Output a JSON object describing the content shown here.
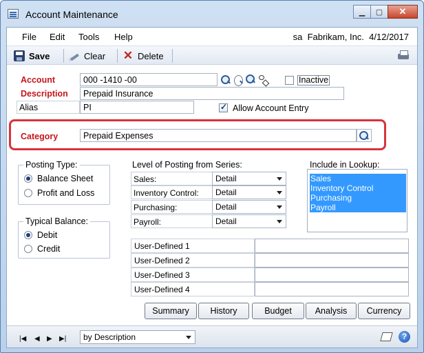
{
  "window": {
    "title": "Account Maintenance"
  },
  "menu": {
    "items": [
      "File",
      "Edit",
      "Tools",
      "Help"
    ],
    "user": "sa",
    "company": "Fabrikam, Inc.",
    "date": "4/12/2017"
  },
  "toolbar": {
    "save": "Save",
    "clear": "Clear",
    "delete": "Delete"
  },
  "form": {
    "account_label": "Account",
    "account_value": "000 -1410 -00",
    "inactive_label": "Inactive",
    "inactive_checked": false,
    "description_label": "Description",
    "description_value": "Prepaid Insurance",
    "alias_label": "Alias",
    "alias_value": "PI",
    "allow_entry_label": "Allow Account Entry",
    "allow_entry_checked": true,
    "category_label": "Category",
    "category_value": "Prepaid Expenses"
  },
  "posting_type": {
    "title": "Posting Type:",
    "options": [
      "Balance Sheet",
      "Profit and Loss"
    ],
    "selected": "Balance Sheet"
  },
  "typical_balance": {
    "title": "Typical Balance:",
    "options": [
      "Debit",
      "Credit"
    ],
    "selected": "Debit"
  },
  "level_of_posting": {
    "title": "Level of Posting from Series:",
    "rows": [
      {
        "label": "Sales:",
        "value": "Detail"
      },
      {
        "label": "Inventory Control:",
        "value": "Detail"
      },
      {
        "label": "Purchasing:",
        "value": "Detail"
      },
      {
        "label": "Payroll:",
        "value": "Detail"
      }
    ]
  },
  "include_in_lookup": {
    "title": "Include in Lookup:",
    "items": [
      "Sales",
      "Inventory Control",
      "Purchasing",
      "Payroll"
    ]
  },
  "user_defined": [
    "User-Defined 1",
    "User-Defined 2",
    "User-Defined 3",
    "User-Defined 4"
  ],
  "buttons": [
    "Summary",
    "History",
    "Budget",
    "Analysis",
    "Currency"
  ],
  "status": {
    "sort_by": "by Description"
  },
  "colors": {
    "required_label": "#c4161c",
    "highlight": "#d8323c",
    "selection": "#3399ff"
  }
}
